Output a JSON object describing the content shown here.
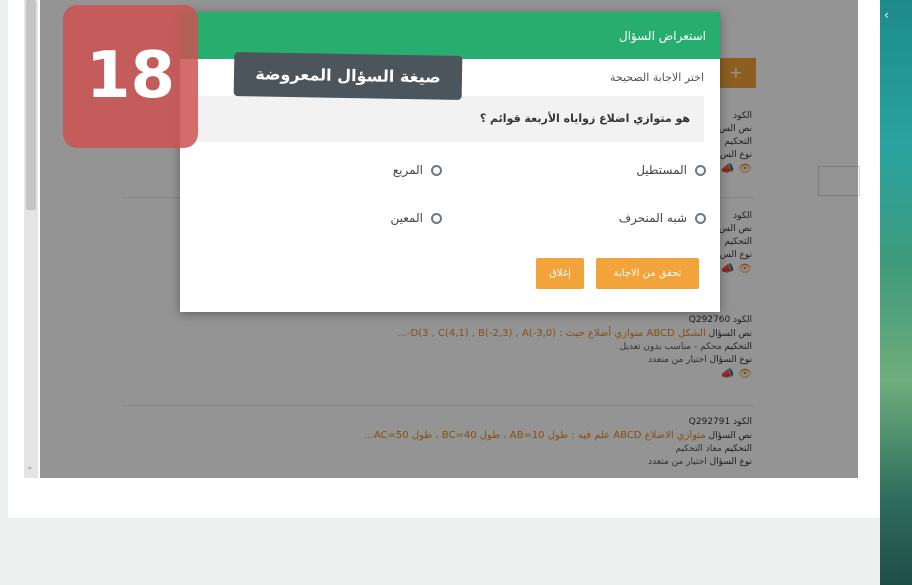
{
  "modal": {
    "title": "استعراض السؤال",
    "subtitle": "اختر الاجابة الصحيحة",
    "question": "هو متوازي اضلاع زواياه الأربعة قوائم ؟",
    "options": [
      {
        "label": "المستطيل"
      },
      {
        "label": "المربع"
      },
      {
        "label": "شبه المنحرف"
      },
      {
        "label": "المعين"
      }
    ],
    "verify_button": "تحقق من الاجابة",
    "close_button": "إغلاق"
  },
  "overlay": {
    "step_number": "18",
    "caption": "صيغة السؤال المعروضة"
  },
  "toolbar": {
    "add_label": "+"
  },
  "questions": [
    {
      "code_label": "الكود",
      "code": "Q292760",
      "text_label": "نص السؤال",
      "text": "الشكل ABCD متوازي أضلاع حيث : D(3 , C(4,1) , B(-2,3) , A(-3,0)-...",
      "grading_label": "التحكيم",
      "grading": "محكم - مناسب بدون تعديل",
      "type_label": "نوع السؤال",
      "type": "اختيار من متعدد"
    },
    {
      "code_label": "الكود",
      "code": "Q292791",
      "text_label": "نص السؤال",
      "text": "متوازي الاضلاع ABCD علم فيه : طول AB=10 ، طول BC=40 ، طول AC=50...",
      "grading_label": "التحكيم",
      "grading": "معاد التحكيم",
      "type_label": "نوع السؤال",
      "type": "اختيار من متعدد"
    }
  ],
  "partial_rows": [
    {
      "l1": "الكود",
      "l2": "نص الس",
      "l3": "التحكيم",
      "l4": "نوع الس"
    },
    {
      "l1": "الكود",
      "l2": "نص الس",
      "l3": "التحكيم",
      "l4": "نوع الس"
    }
  ]
}
